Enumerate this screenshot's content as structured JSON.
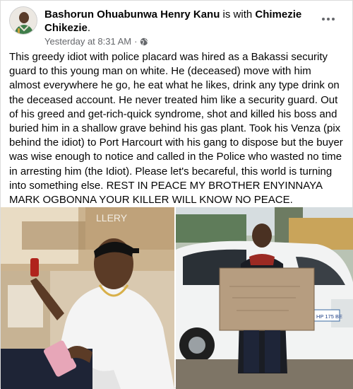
{
  "post": {
    "author": "Bashorun Ohuabunwa Henry Kanu",
    "connector": "is with",
    "tagged": "Chimezie Chikezie",
    "tagged_suffix": ".",
    "timestamp": "Yesterday at 8:31 AM",
    "separator": "·",
    "audience_icon": "globe-icon",
    "more_icon": "more-options-icon",
    "body": "This greedy idiot with police placard was hired as a Bakassi security guard to this young man on white. He (deceased) move with him almost everywhere he go, he eat what he likes, drink any type drink on the deceased account. He never treated him like a security guard. Out of his greed and get-rich-quick syndrome, shot and killed his boss and buried him in a shallow grave behind his gas plant. Took his Venza (pix behind the idiot) to Port Harcourt with his gang to dispose but the buyer was wise enough to notice and called in the Police who wasted no time in arresting him (the Idiot). Please let's becareful, this world is turning into something else. REST IN PEACE MY BROTHER ENYINNAYA MARK OGBONNA YOUR KILLER WILL KNOW NO PEACE."
  },
  "photos": {
    "left_sign_text": "LLERY",
    "right_plate_text": "HP 175 BE"
  },
  "colors": {
    "text": "#050505",
    "meta": "#65676b"
  }
}
